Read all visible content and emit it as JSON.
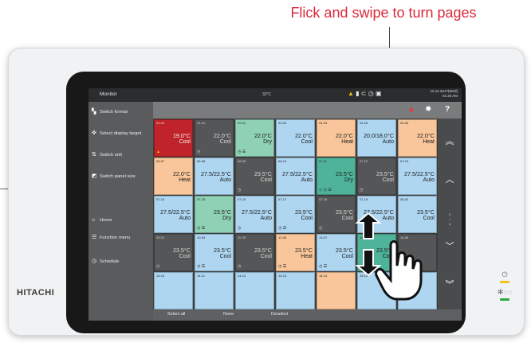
{
  "callout": {
    "label": "Flick and swipe to turn pages"
  },
  "device": {
    "brand": "HITACHI"
  },
  "app": {
    "title": "Monitor",
    "temp_readout": "32°C",
    "date": "15.11.2017(Wed)",
    "time": "01:20 AM"
  },
  "sidebar": {
    "items": [
      {
        "label": "Switch format",
        "icon": "grid-icon"
      },
      {
        "label": "Select display target",
        "icon": "target-icon"
      },
      {
        "label": "Switch unit",
        "icon": "unit-icon"
      },
      {
        "label": "Switch panel size",
        "icon": "panel-icon"
      },
      {
        "label": "Home",
        "icon": "home-icon"
      },
      {
        "label": "Function menu",
        "icon": "list-icon"
      },
      {
        "label": "Schedule",
        "icon": "clock-icon"
      }
    ]
  },
  "tiles": [
    [
      {
        "id": "01-01",
        "temp": "19.0°C",
        "mode": "Cool",
        "bg": "#c0232a",
        "fg": "#f3f3f3",
        "icon": "warning"
      },
      {
        "id": "01-01",
        "temp": "22.0°C",
        "mode": "Cool",
        "bg": "#555657",
        "fg": "#dcdcdc",
        "icon": "clock"
      },
      {
        "id": "02-02",
        "temp": "22.0°C",
        "mode": "Dry",
        "bg": "#8ed1b4",
        "fg": "#1c1c1c",
        "icon": "clock-list"
      },
      {
        "id": "03-03",
        "temp": "22.0°C",
        "mode": "Cool",
        "bg": "#aed6f1",
        "fg": "#1c1c1c",
        "icon": ""
      },
      {
        "id": "04-04",
        "temp": "22.0°C",
        "mode": "Heat",
        "bg": "#f8c69a",
        "fg": "#1c1c1c",
        "icon": ""
      },
      {
        "id": "04-05",
        "temp": "20.0/18.0°C",
        "mode": "Auto",
        "bg": "#aed6f1",
        "fg": "#1c1c1c",
        "icon": ""
      },
      {
        "id": "05-06",
        "temp": "22.0°C",
        "mode": "Heat",
        "bg": "#f8c69a",
        "fg": "#1c1c1c",
        "icon": ""
      }
    ],
    [
      {
        "id": "05-07",
        "temp": "22.0°C",
        "mode": "Heat",
        "bg": "#f8c69a",
        "fg": "#1c1c1c",
        "icon": ""
      },
      {
        "id": "06-08",
        "temp": "27.5/22.5°C",
        "mode": "Auto",
        "bg": "#aed6f1",
        "fg": "#1c1c1c",
        "icon": ""
      },
      {
        "id": "06-09",
        "temp": "23.5°C",
        "mode": "Cool",
        "bg": "#555657",
        "fg": "#dcdcdc",
        "icon": "clock"
      },
      {
        "id": "06-10",
        "temp": "27.5/22.5°C",
        "mode": "Auto",
        "bg": "#aed6f1",
        "fg": "#1c1c1c",
        "icon": ""
      },
      {
        "id": "07-11",
        "temp": "23.5°C",
        "mode": "Dry",
        "bg": "#4fb39a",
        "fg": "#1c1c1c",
        "icon": "ctrl"
      },
      {
        "id": "07-12",
        "temp": "23.5°C",
        "mode": "Cool",
        "bg": "#555657",
        "fg": "#dcdcdc",
        "icon": "clock"
      },
      {
        "id": "07-13",
        "temp": "27.5/22.5°C",
        "mode": "Auto",
        "bg": "#aed6f1",
        "fg": "#1c1c1c",
        "icon": ""
      }
    ],
    [
      {
        "id": "07-14",
        "temp": "27.5/22.5°C",
        "mode": "Auto",
        "bg": "#aed6f1",
        "fg": "#1c1c1c",
        "icon": ""
      },
      {
        "id": "07-15",
        "temp": "23.5°C",
        "mode": "Dry",
        "bg": "#8ed1b4",
        "fg": "#1c1c1c",
        "icon": "clock-list"
      },
      {
        "id": "07-16",
        "temp": "27.5/22.5°C",
        "mode": "Auto",
        "bg": "#aed6f1",
        "fg": "#1c1c1c",
        "icon": "clock"
      },
      {
        "id": "07-17",
        "temp": "23.5°C",
        "mode": "Cool",
        "bg": "#aed6f1",
        "fg": "#1c1c1c",
        "icon": "clock-list"
      },
      {
        "id": "07-18",
        "temp": "23.5°C",
        "mode": "Cool",
        "bg": "#555657",
        "fg": "#dcdcdc",
        "icon": "clock"
      },
      {
        "id": "07-19",
        "temp": "27.5/22.5°C",
        "mode": "Auto",
        "bg": "#aed6f1",
        "fg": "#1c1c1c",
        "icon": ""
      },
      {
        "id": "08-02",
        "temp": "23.5°C",
        "mode": "Cool",
        "bg": "#aed6f1",
        "fg": "#1c1c1c",
        "icon": ""
      }
    ],
    [
      {
        "id": "09-01",
        "temp": "23.5°C",
        "mode": "Cool",
        "bg": "#555657",
        "fg": "#dcdcdc",
        "icon": "clock"
      },
      {
        "id": "10-04",
        "temp": "23.5°C",
        "mode": "Cool",
        "bg": "#aed6f1",
        "fg": "#1c1c1c",
        "icon": "clock-list"
      },
      {
        "id": "11-05",
        "temp": "23.5°C",
        "mode": "Cool",
        "bg": "#555657",
        "fg": "#dcdcdc",
        "icon": "clock"
      },
      {
        "id": "12-06",
        "temp": "23.5°C",
        "mode": "Heat",
        "bg": "#f8c69a",
        "fg": "#1c1c1c",
        "icon": "clock-list"
      },
      {
        "id": "13-07",
        "temp": "23.5°C",
        "mode": "Cool",
        "bg": "#aed6f1",
        "fg": "#1c1c1c",
        "icon": "clock-list"
      },
      {
        "id": "14-08",
        "temp": "23.5°C",
        "mode": "Cool",
        "bg": "#4fb39a",
        "fg": "#1c1c1c",
        "icon": ""
      },
      {
        "id": "14-09",
        "temp": "",
        "mode": "",
        "bg": "#555657",
        "fg": "#dcdcdc",
        "icon": ""
      }
    ],
    [
      {
        "id": "14-10",
        "temp": "",
        "mode": "",
        "bg": "#aed6f1",
        "fg": "#1c1c1c",
        "icon": ""
      },
      {
        "id": "14-11",
        "temp": "",
        "mode": "",
        "bg": "#aed6f1",
        "fg": "#1c1c1c",
        "icon": ""
      },
      {
        "id": "14-12",
        "temp": "",
        "mode": "",
        "bg": "#aed6f1",
        "fg": "#1c1c1c",
        "icon": ""
      },
      {
        "id": "14-13",
        "temp": "",
        "mode": "",
        "bg": "#aed6f1",
        "fg": "#1c1c1c",
        "icon": ""
      },
      {
        "id": "15-14",
        "temp": "",
        "mode": "",
        "bg": "#f8c69a",
        "fg": "#1c1c1c",
        "icon": ""
      },
      {
        "id": "15-15",
        "temp": "",
        "mode": "",
        "bg": "#aed6f1",
        "fg": "#1c1c1c",
        "icon": ""
      },
      {
        "id": "15-16",
        "temp": "",
        "mode": "",
        "bg": "#aed6f1",
        "fg": "#1c1c1c",
        "icon": ""
      }
    ]
  ],
  "scroll": {
    "page": "3",
    "total": "4"
  },
  "bottom": {
    "select_all": "Select all",
    "none": "None",
    "deselect": "Deselect"
  },
  "colors": {
    "accent_red": "#d92a3a",
    "screen_bg": "#3c3c3c",
    "bezel": "#181818"
  }
}
